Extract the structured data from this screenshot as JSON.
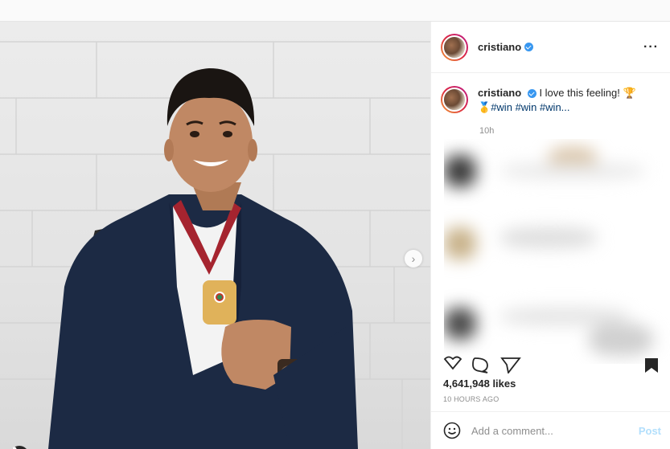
{
  "post": {
    "username": "cristiano",
    "verified": true,
    "more_icon": "more-horizontal-icon",
    "caption_text": "I love this feeling!",
    "caption_emoji": "🏆",
    "caption_medal": "🥇",
    "hashtags": [
      "#win",
      "#win",
      "#win..."
    ],
    "time_short": "10h",
    "likes": "4,641,948 likes",
    "time_long": "10 HOURS AGO"
  },
  "media": {
    "carousel_count": 2,
    "carousel_active": 1
  },
  "comment": {
    "placeholder": "Add a comment...",
    "post_label": "Post"
  },
  "colors": {
    "accent": "#3897f0",
    "hashtag": "#00376b",
    "post_disabled": "#b2dffc"
  }
}
